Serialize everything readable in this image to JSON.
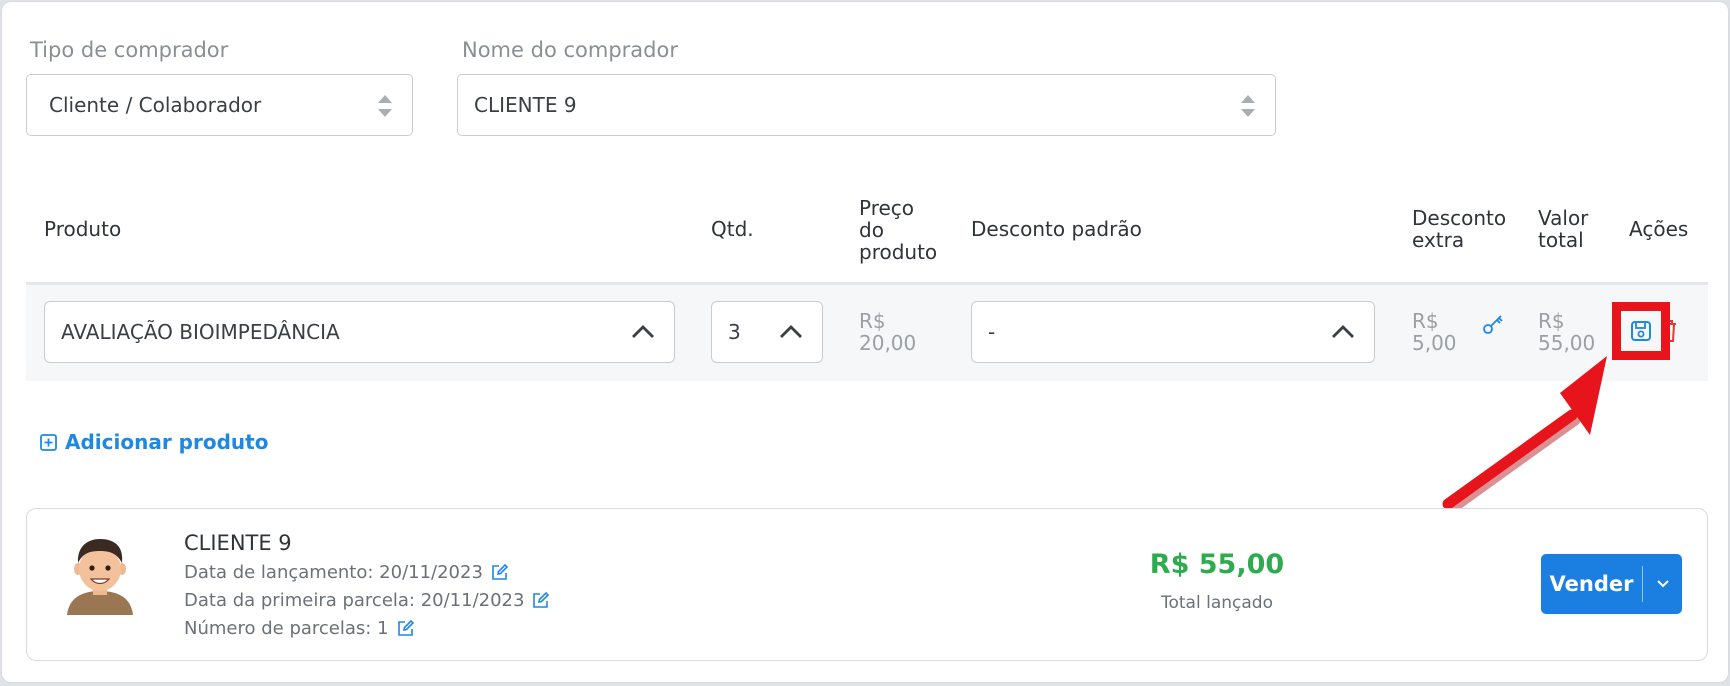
{
  "filters": {
    "buyer_type_label": "Tipo de comprador",
    "buyer_type_value": "Cliente / Colaborador",
    "buyer_name_label": "Nome do comprador",
    "buyer_name_value": "CLIENTE 9"
  },
  "table": {
    "headers": {
      "produto": "Produto",
      "qtd": "Qtd.",
      "preco_l1": "Preço",
      "preco_l2": "do",
      "preco_l3": "produto",
      "desconto_padrao": "Desconto padrão",
      "desconto_extra_l1": "Desconto",
      "desconto_extra_l2": "extra",
      "valor_total_l1": "Valor",
      "valor_total_l2": "total",
      "acoes": "Ações"
    },
    "row": {
      "produto": "AVALIAÇÃO BIOIMPEDÂNCIA",
      "qtd": "3",
      "preco_currency": "R$",
      "preco_value": "20,00",
      "desconto_padrao": "-",
      "desconto_extra_currency": "R$",
      "desconto_extra_value": "5,00",
      "valor_total_currency": "R$",
      "valor_total_value": "55,00"
    }
  },
  "add_product_label": "Adicionar produto",
  "summary": {
    "client_name": "CLIENTE 9",
    "launch_date": "Data de lançamento: 20/11/2023",
    "first_installment": "Data da primeira parcela: 20/11/2023",
    "installments": "Número de parcelas: 1",
    "total_value": "R$ 55,00",
    "total_label": "Total lançado",
    "sell_label": "Vender"
  },
  "colors": {
    "primary": "#1a7fe0",
    "link": "#1e88e5",
    "total_green": "#2eab4f",
    "delete_red": "#e53935",
    "annotation_red": "#e8141c"
  },
  "icons": [
    "updown-icon",
    "chevron-up-icon",
    "key-icon",
    "save-icon",
    "trash-icon",
    "plus-square-icon",
    "edit-icon",
    "avatar",
    "chevron-down-icon"
  ]
}
